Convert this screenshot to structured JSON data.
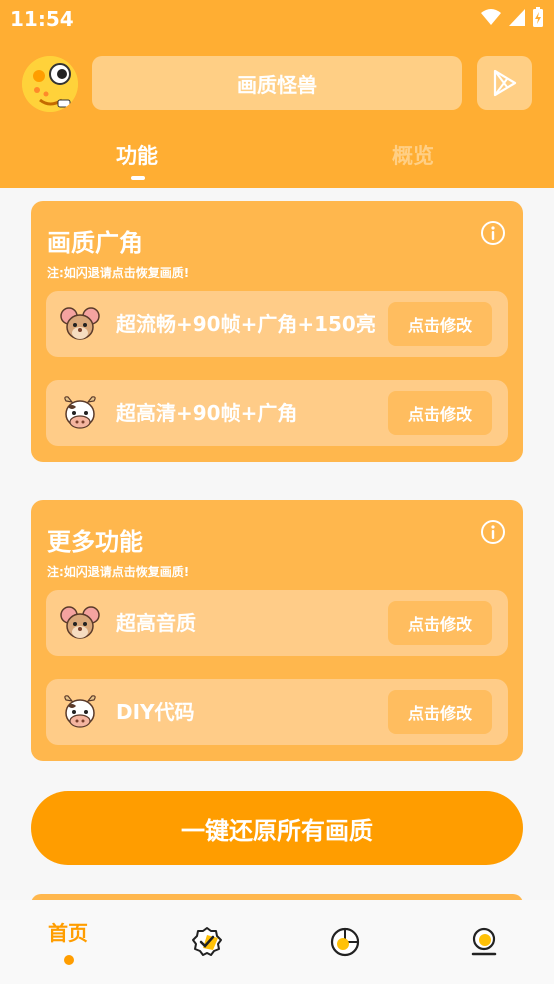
{
  "status_bar": {
    "time": "11:54"
  },
  "header": {
    "title": "画质怪兽",
    "avatar_icon": "cartoon-monster-avatar",
    "play_icon": "play-store-icon"
  },
  "tabs": [
    {
      "label": "功能",
      "active": true
    },
    {
      "label": "概览",
      "active": false
    }
  ],
  "sections": [
    {
      "title": "画质广角",
      "note": "注:如闪退请点击恢复画质!",
      "items": [
        {
          "icon": "mouse-face-icon",
          "label": "超流畅+90帧+广角+150亮",
          "button": "点击修改"
        },
        {
          "icon": "cow-face-icon",
          "label": "超高清+90帧+广角",
          "button": "点击修改"
        }
      ]
    },
    {
      "title": "更多功能",
      "note": "注:如闪退请点击恢复画质!",
      "items": [
        {
          "icon": "mouse-face-icon",
          "label": "超高音质",
          "button": "点击修改"
        },
        {
          "icon": "cow-face-icon",
          "label": "DIY代码",
          "button": "点击修改"
        }
      ]
    }
  ],
  "restore_button": "一键还原所有画质",
  "bottom_nav": [
    {
      "label": "首页",
      "icon": "home",
      "active": true
    },
    {
      "label": "",
      "icon": "verified-badge-icon",
      "active": false
    },
    {
      "label": "",
      "icon": "pie-chart-icon",
      "active": false
    },
    {
      "label": "",
      "icon": "profile-icon",
      "active": false
    }
  ],
  "colors": {
    "primary": "#ffae33",
    "card": "#ffb74d",
    "row": "#ffcc88",
    "accent": "#ff9d00"
  }
}
